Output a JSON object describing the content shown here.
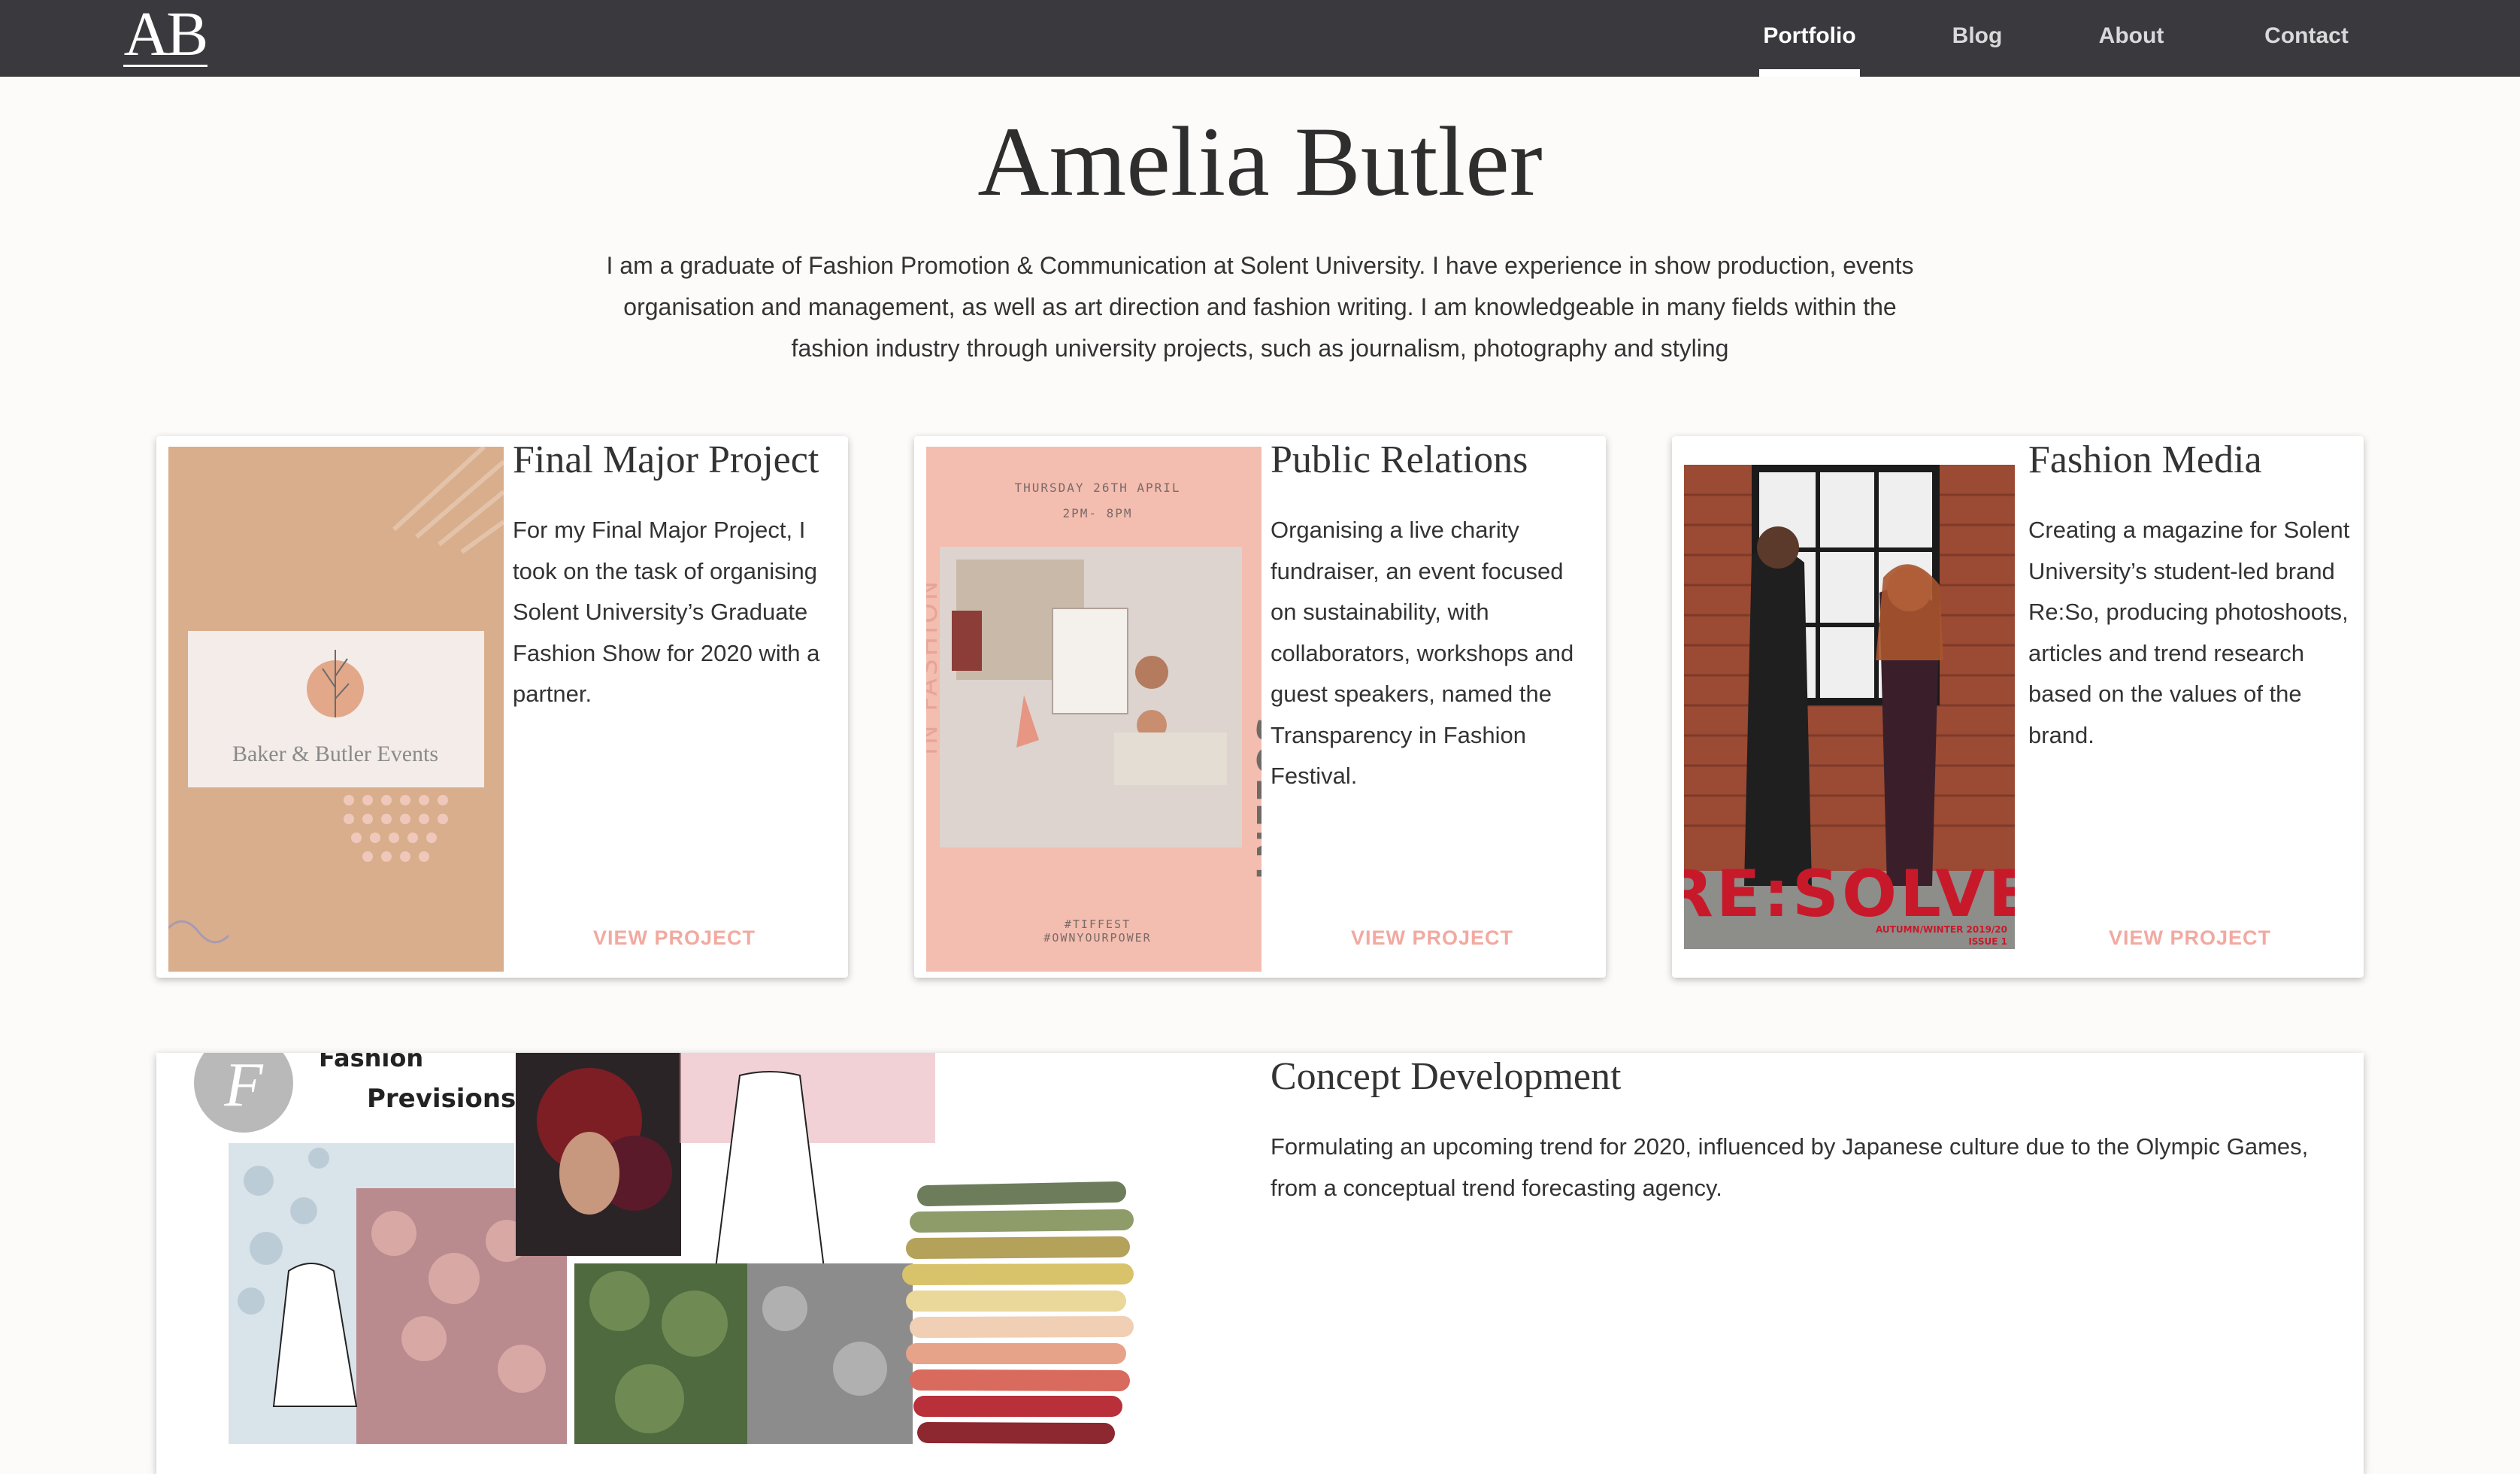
{
  "brand": {
    "logo_text": "AB"
  },
  "nav": {
    "items": [
      {
        "label": "Portfolio",
        "active": true
      },
      {
        "label": "Blog",
        "active": false
      },
      {
        "label": "About",
        "active": false
      },
      {
        "label": "Contact",
        "active": false
      }
    ]
  },
  "hero": {
    "name": "Amelia Butler",
    "intro": "I am a graduate of Fashion Promotion & Communication at Solent University. I have experience in show production, events organisation and management, as well as art direction and fashion writing. I am knowledgeable in many fields within the fashion industry through university projects, such as journalism, photography and styling"
  },
  "projects": [
    {
      "title": "Final Major Project",
      "description": "For my Final Major Project, I took on the task of organising Solent University’s Graduate Fashion Show for 2020 with a partner.",
      "cta": "VIEW PROJECT",
      "image_text": "Baker & Butler Events"
    },
    {
      "title": "Public Relations",
      "description": "Organising a live charity fundraiser, an event focused on sustainability, with collaborators, workshops and guest speakers, named the Transparency in Fashion Festival.",
      "cta": "VIEW PROJECT",
      "image_text": {
        "date": "THURSDAY 26TH APRIL",
        "time": "2PM- 8PM",
        "hashtag1": "#TIFFEST",
        "hashtag2": "#OWNYOURPOWER",
        "side_left": "IN FASHION",
        "side_right": "SOLENT"
      }
    },
    {
      "title": "Fashion Media",
      "description": "Creating a magazine for Solent University’s student-led brand Re:So, producing photoshoots, articles and trend research based on the values of the brand.",
      "cta": "VIEW PROJECT",
      "image_text": {
        "masthead": "RE:SOLVE",
        "issue": "AUTUMN/WINTER 2019/20",
        "issue_no": "ISSUE 1"
      }
    }
  ],
  "feature": {
    "title": "Concept Development",
    "description": "Formulating an upcoming trend for 2020, influenced by Japanese culture due to the Olympic Games, from a conceptual trend forecasting agency.",
    "image_text": {
      "line1": "Fashion",
      "line2": "Previsions",
      "monogram": "F"
    }
  },
  "colors": {
    "header_bg": "#3a3a3e",
    "accent": "#f2a9a0",
    "page_bg": "#fdfafa"
  }
}
